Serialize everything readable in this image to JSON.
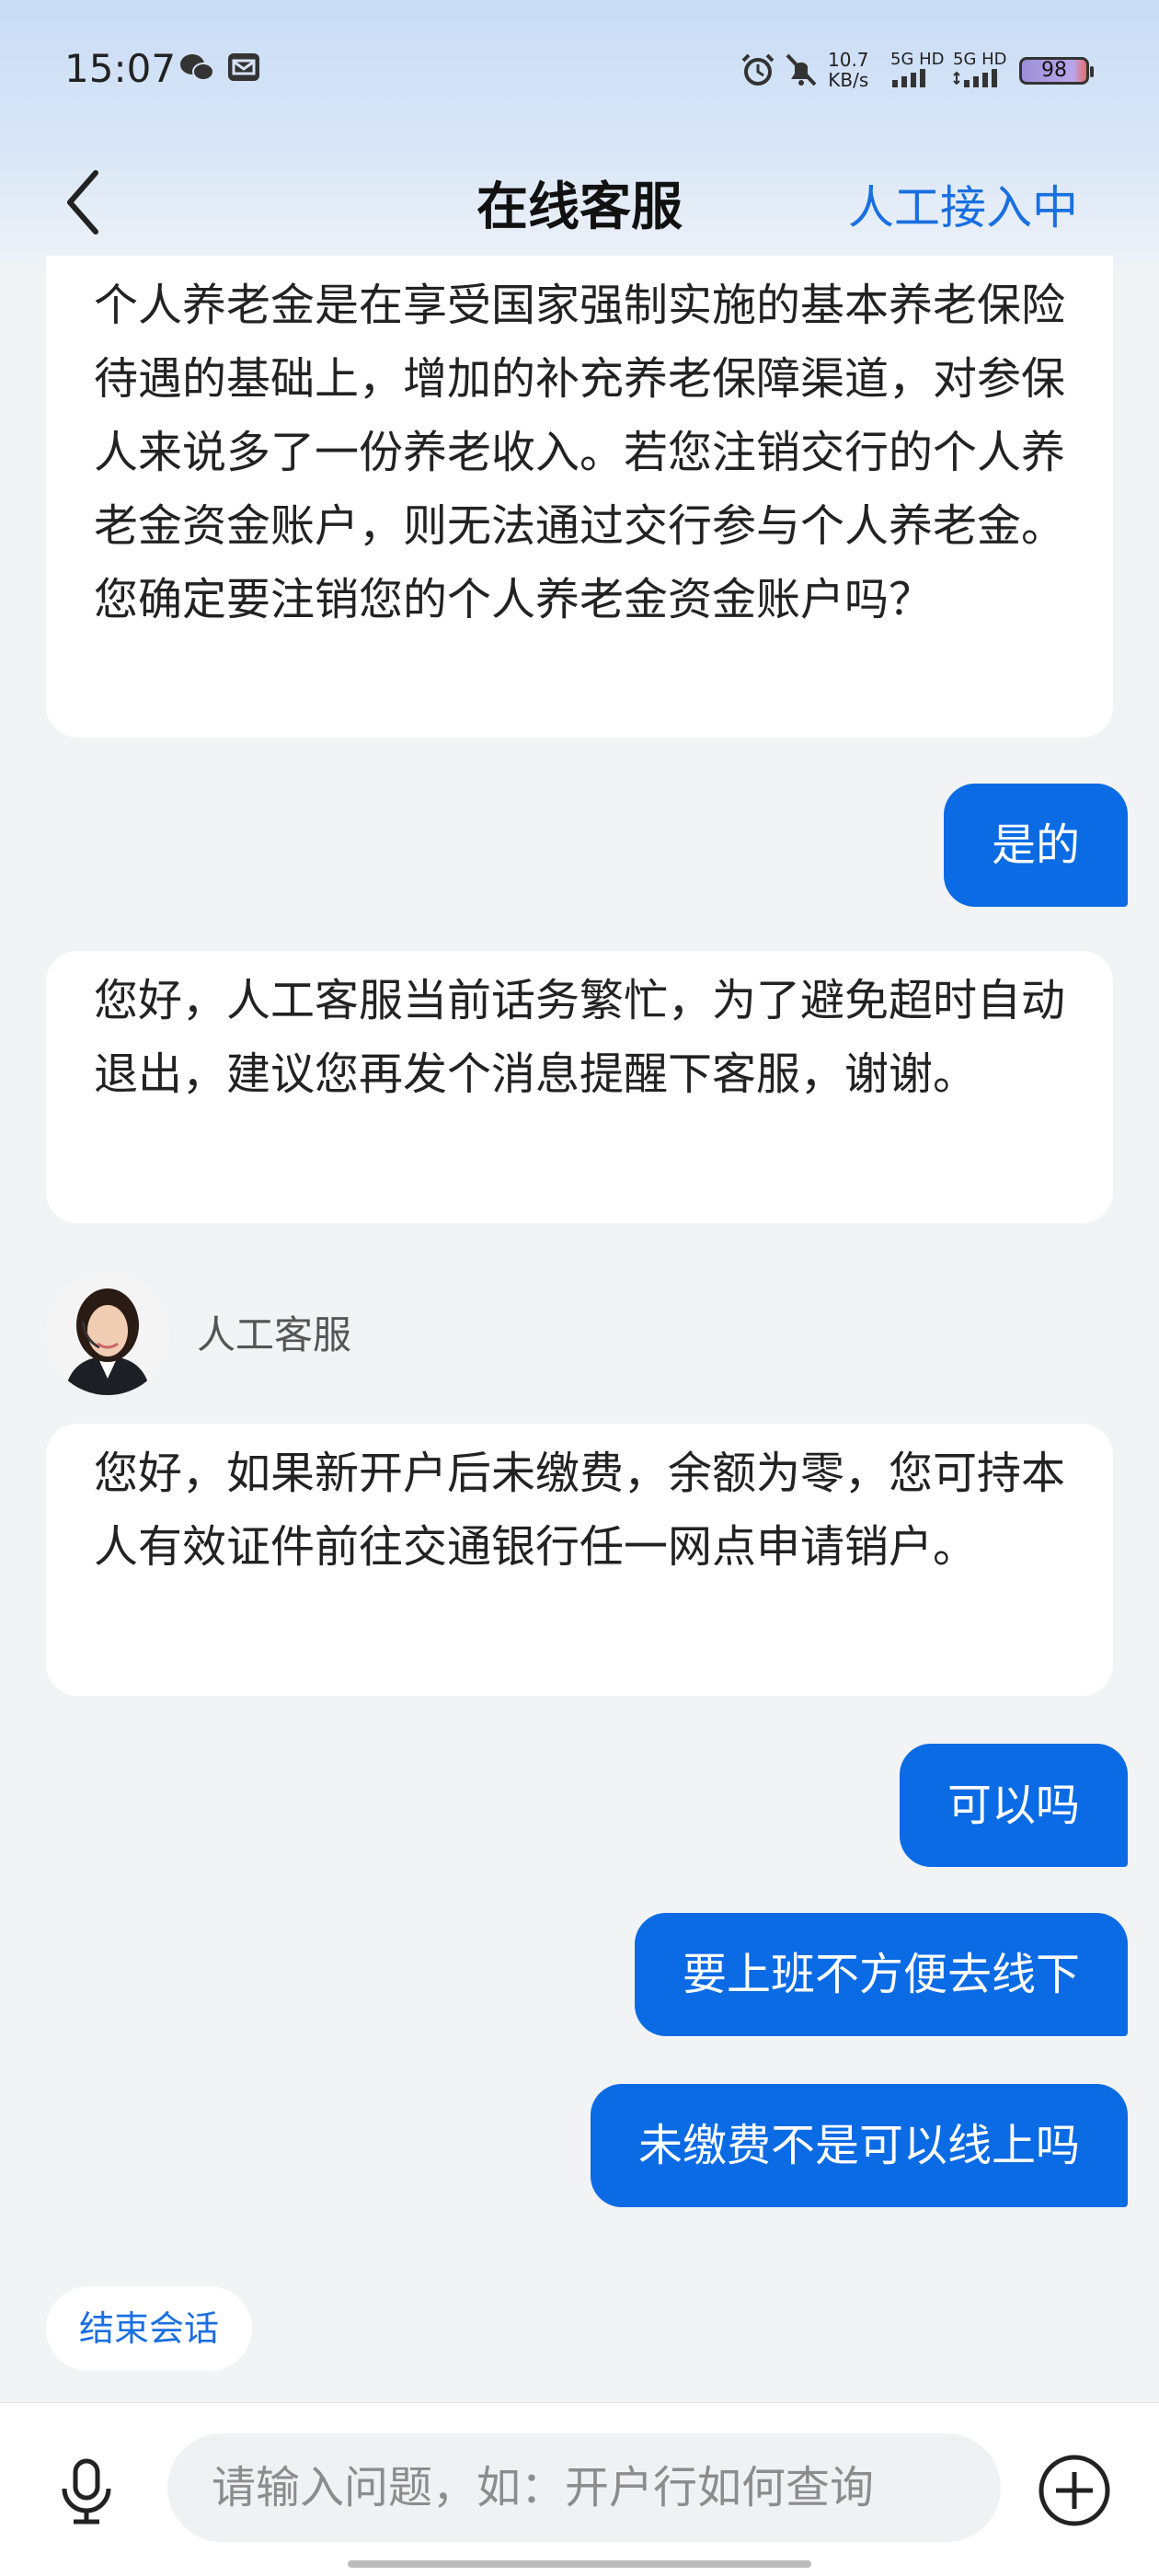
{
  "status_bar": {
    "time": "15:07",
    "net_speed_value": "10.7",
    "net_speed_unit": "KB/s",
    "sim1": "5G HD",
    "sim2": "5G HD",
    "battery": "98",
    "icons": [
      "wechat-icon",
      "mail-icon",
      "alarm-icon",
      "mute-icon",
      "signal-icon"
    ]
  },
  "header": {
    "title": "在线客服",
    "status": "人工接入中",
    "accent_color": "#1a6fe0"
  },
  "messages": [
    {
      "from": "agent",
      "text": "个人养老金是在享受国家强制实施的基本养老保险待遇的基础上，增加的补充养老保障渠道，对参保人来说多了一份养老收入。若您注销交行的个人养老金资金账户，则无法通过交行参与个人养老金。您确定要注销您的个人养老金资金账户吗？"
    },
    {
      "from": "user",
      "text": "是的"
    },
    {
      "from": "agent",
      "text": "您好，人工客服当前话务繁忙，为了避免超时自动退出，建议您再发个消息提醒下客服，谢谢。"
    },
    {
      "from": "agent",
      "sender": "人工客服",
      "text": "您好，如果新开户后未缴费，余额为零，您可持本人有效证件前往交通银行任一网点申请销户。"
    },
    {
      "from": "user",
      "text": "可以吗"
    },
    {
      "from": "user",
      "text": "要上班不方便去线下"
    },
    {
      "from": "user",
      "text": "未缴费不是可以线上吗"
    }
  ],
  "end_chat_label": "结束会话",
  "input": {
    "placeholder": "请输入问题，如：开户行如何查询"
  },
  "user_bubble_color": "#0a6be4"
}
